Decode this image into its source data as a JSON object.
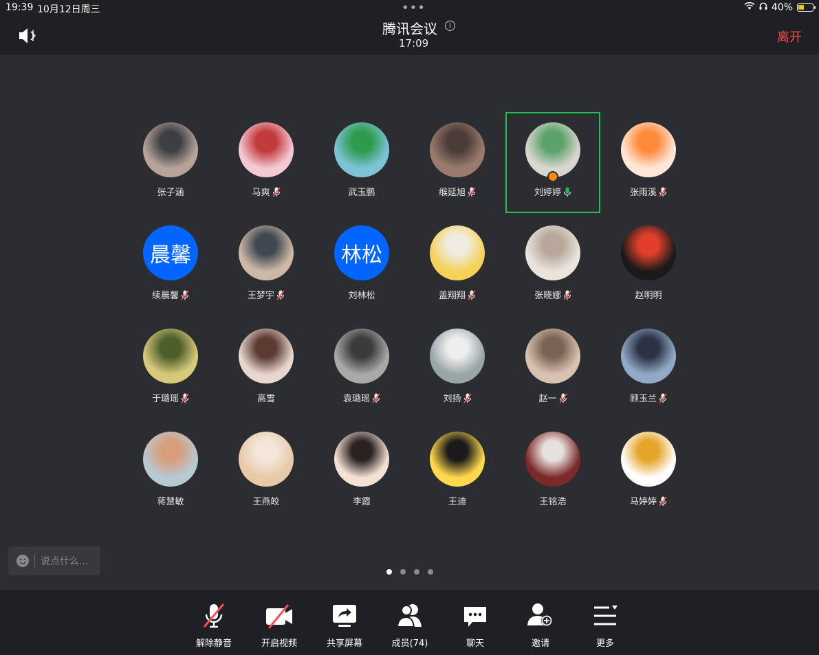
{
  "status_bar": {
    "time": "19:39",
    "date": "10月12日周三",
    "battery": "40%",
    "battery_level": 0.4
  },
  "header": {
    "title": "腾讯会议",
    "timer": "17:09",
    "leave_label": "离开"
  },
  "participants": [
    {
      "name": "张子涵",
      "muted": false
    },
    {
      "name": "马爽",
      "muted": true
    },
    {
      "name": "武玉鹏",
      "muted": false
    },
    {
      "name": "缑延旭",
      "muted": true
    },
    {
      "name": "刘婷婷",
      "muted": false,
      "speaking": true,
      "host": true
    },
    {
      "name": "张雨溪",
      "muted": true
    },
    {
      "name": "续晨馨",
      "muted": true,
      "avatar_text": "晨馨"
    },
    {
      "name": "王梦宇",
      "muted": true
    },
    {
      "name": "刘林松",
      "muted": false,
      "avatar_text": "林松"
    },
    {
      "name": "盖翔翔",
      "muted": true
    },
    {
      "name": "张晓娜",
      "muted": true
    },
    {
      "name": "赵明明",
      "muted": false
    },
    {
      "name": "于璐瑶",
      "muted": true
    },
    {
      "name": "高雪",
      "muted": false
    },
    {
      "name": "袁璐瑶",
      "muted": true
    },
    {
      "name": "刘扬",
      "muted": true
    },
    {
      "name": "赵一",
      "muted": true
    },
    {
      "name": "顾玉兰",
      "muted": true
    },
    {
      "name": "蒋慧敏",
      "muted": false
    },
    {
      "name": "王燕皎",
      "muted": false
    },
    {
      "name": "李霞",
      "muted": false
    },
    {
      "name": "王迪",
      "muted": false
    },
    {
      "name": "王铭浩",
      "muted": false
    },
    {
      "name": "马婷婷",
      "muted": true
    }
  ],
  "chat": {
    "placeholder": "说点什么..."
  },
  "pager": {
    "pages": 4,
    "current": 1
  },
  "toolbar": {
    "unmute_label": "解除静音",
    "video_label": "开启视频",
    "share_label": "共享屏幕",
    "members_label": "成员(74)",
    "chat_label": "聊天",
    "invite_label": "邀请",
    "more_label": "更多"
  },
  "colors": {
    "accent_leave": "#ff4d4f",
    "speaking": "#1dbf55",
    "mute_slash": "#ff4d4f",
    "name_avatar_bg": "#0066ff"
  }
}
